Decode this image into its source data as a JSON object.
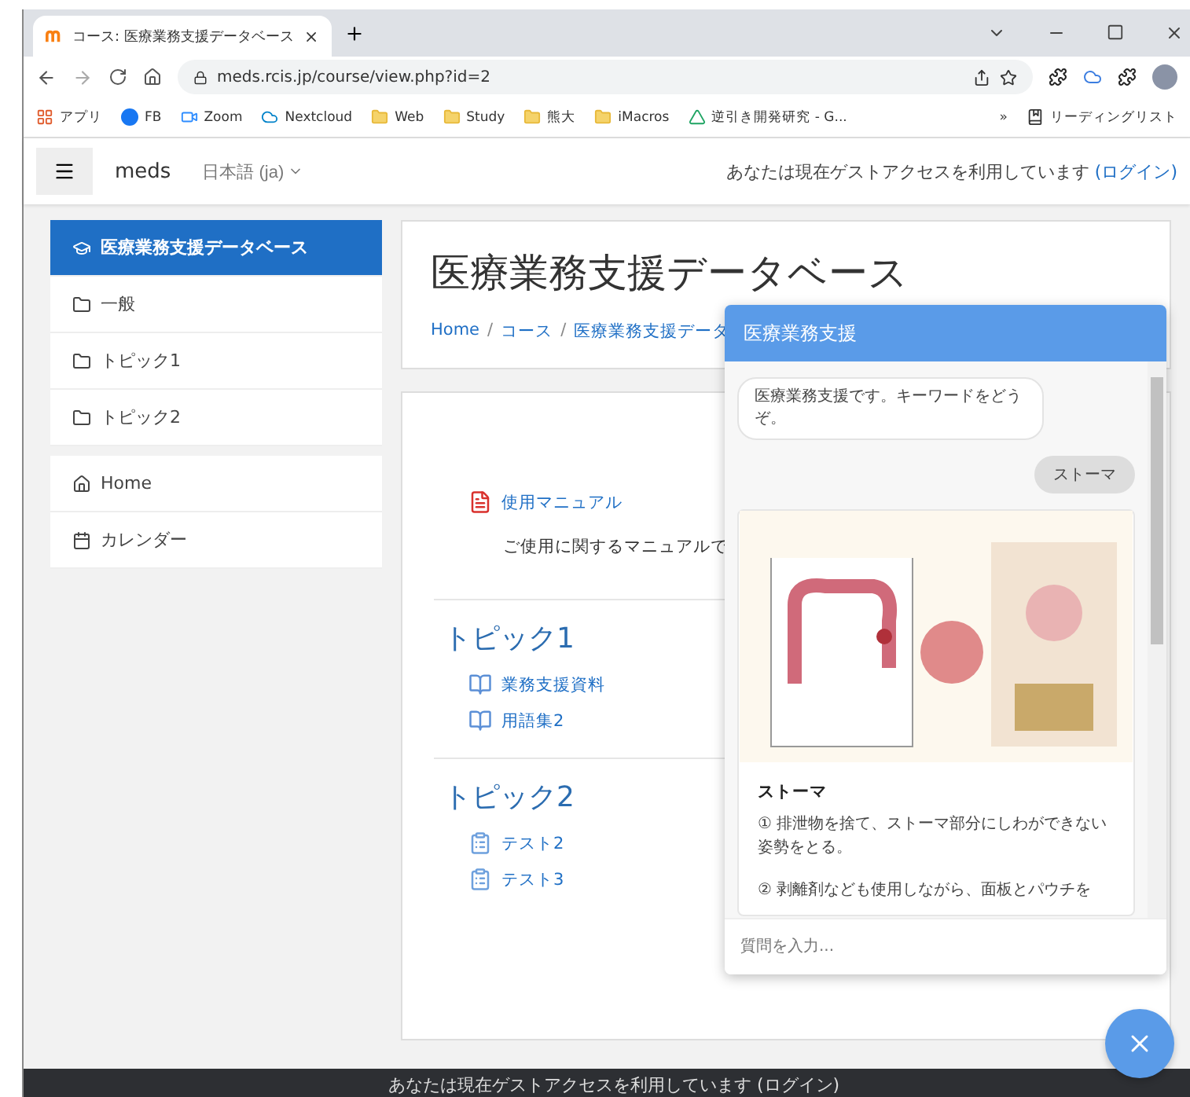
{
  "browser": {
    "tab_title": "コース: 医療業務支援データベース",
    "url": "meds.rcis.jp/course/view.php?id=2",
    "bookmarks": [
      {
        "label": "アプリ",
        "kind": "apps"
      },
      {
        "label": "FB",
        "kind": "facebook"
      },
      {
        "label": "Zoom",
        "kind": "zoom"
      },
      {
        "label": "Nextcloud",
        "kind": "nextcloud"
      },
      {
        "label": "Web",
        "kind": "folder"
      },
      {
        "label": "Study",
        "kind": "folder"
      },
      {
        "label": "熊大",
        "kind": "folder"
      },
      {
        "label": "iMacros",
        "kind": "folder"
      },
      {
        "label": "逆引き開発研究 - G...",
        "kind": "drive"
      }
    ],
    "overflow": "»",
    "reading_list": "リーディングリスト"
  },
  "navbar": {
    "site": "meds",
    "language": "日本語 (ja)",
    "guest_notice": "あなたは現在ゲストアクセスを利用しています",
    "login": "(ログイン)"
  },
  "sidebar": {
    "groups": [
      {
        "items": [
          {
            "label": "医療業務支援データベース",
            "kind": "course",
            "selected": true
          },
          {
            "label": "一般",
            "kind": "folder",
            "selected": false
          },
          {
            "label": "トピック1",
            "kind": "folder",
            "selected": false
          },
          {
            "label": "トピック2",
            "kind": "folder",
            "selected": false
          }
        ]
      },
      {
        "items": [
          {
            "label": "Home",
            "kind": "home",
            "selected": false
          },
          {
            "label": "カレンダー",
            "kind": "calendar",
            "selected": false
          }
        ]
      }
    ]
  },
  "content": {
    "title": "医療業務支援データベース",
    "breadcrumb": [
      "Home",
      "コース",
      "医療業務支援データ"
    ],
    "breadcrumb_separator": "/",
    "sections": [
      {
        "activities": [
          {
            "label": "使用マニュアル",
            "kind": "pdf",
            "description": "ご使用に関するマニュアルで"
          }
        ]
      },
      {
        "heading": "トピック1",
        "activities": [
          {
            "label": "業務支援資料",
            "kind": "glossary"
          },
          {
            "label": "用語集2",
            "kind": "glossary"
          }
        ]
      },
      {
        "heading": "トピック2",
        "activities": [
          {
            "label": "テスト2",
            "kind": "quiz"
          },
          {
            "label": "テスト3",
            "kind": "quiz"
          }
        ]
      }
    ]
  },
  "chat": {
    "title": "医療業務支援",
    "messages": [
      {
        "kind": "bot",
        "text": "医療業務支援です。キーワードをどうぞ。"
      },
      {
        "kind": "user",
        "text": "ストーマ"
      },
      {
        "kind": "card",
        "title": "ストーマ",
        "lines": [
          "① 排泄物を捨て、ストーマ部分にしわができない姿勢をとる。",
          "② 剥離剤なども使用しながら、面板とパウチを"
        ]
      }
    ],
    "input": {
      "placeholder": "質問を入力..."
    }
  },
  "footer": {
    "text": "あなたは現在ゲストアクセスを利用しています (ログイン)"
  }
}
